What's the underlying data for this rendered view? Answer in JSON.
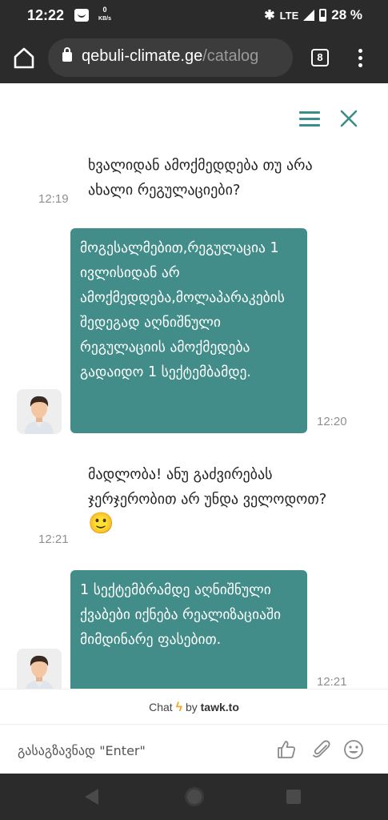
{
  "status_bar": {
    "time": "12:22",
    "data_rate_value": "0",
    "data_rate_unit": "KB/s",
    "network": "LTE",
    "battery": "28 %"
  },
  "browser": {
    "url_domain": "qebuli-climate.ge",
    "url_path": "/catalog",
    "tab_count": "8"
  },
  "chat": {
    "accent_color": "#428c89",
    "messages": [
      {
        "sender": "visitor",
        "time": "12:19",
        "text": "ხვალიდან ამოქმედდება თუ არა ახალი რეგულაციები?"
      },
      {
        "sender": "agent",
        "time": "12:20",
        "text": "მოგესალმებით,რეგულაცია 1 ივლისიდან არ ამოქმედდება,მოლაპარაკების შედეგად აღნიშნული რეგულაციის ამოქმედება გადაიდო 1 სექტემბამდე."
      },
      {
        "sender": "visitor",
        "time": "12:21",
        "text": "მადლობა! ანუ გაძვირებას ჯერჯერობით არ უნდა ველოდოთ?",
        "emoji": "🙂"
      },
      {
        "sender": "agent",
        "time": "12:21",
        "text": "1 სექტემბრამდე აღნიშნული ქვაბები იქნება რეალიზაციაში მიმდინარე ფასებით."
      }
    ],
    "powered_by": {
      "chat": "Chat",
      "by": "by",
      "brand": "tawk.to"
    },
    "input_placeholder": "გასაგზავნად \"Enter\""
  }
}
